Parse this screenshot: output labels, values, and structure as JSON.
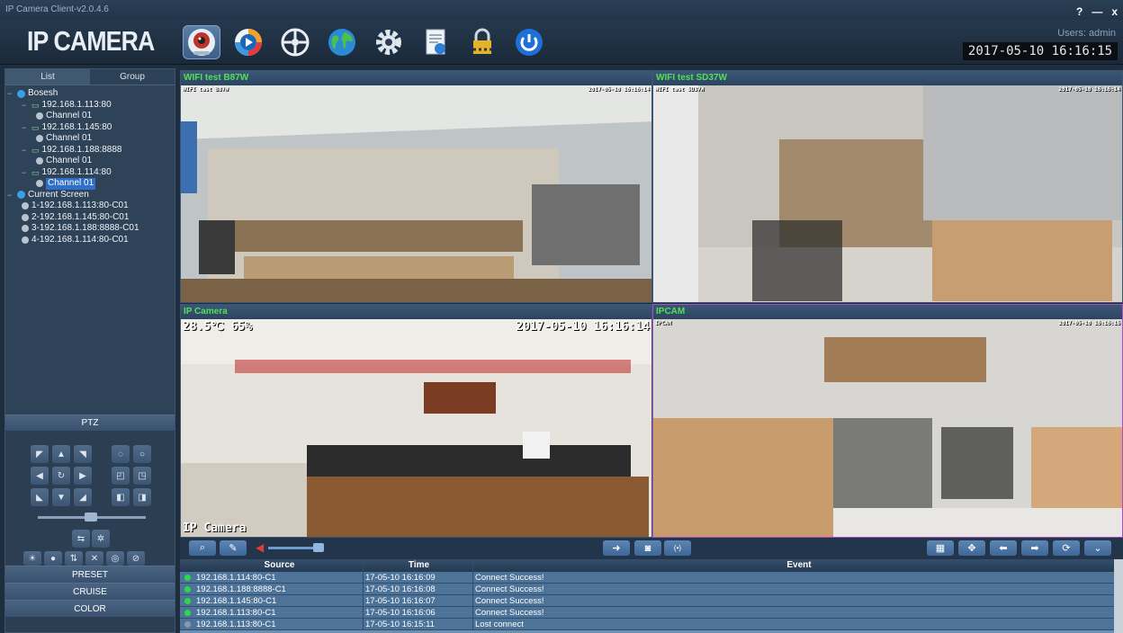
{
  "window": {
    "title": "IP Camera Client-v2.0.4.6",
    "controls": [
      "?",
      "—",
      "x"
    ]
  },
  "header": {
    "logo": "IP CAMERA",
    "user": "Users: admin",
    "clock": "2017-05-10 16:16:15",
    "toolbar": [
      "live-view",
      "playback",
      "ptz-control",
      "network",
      "settings",
      "log",
      "lock",
      "power"
    ]
  },
  "left": {
    "tabs": [
      "List",
      "Group"
    ],
    "tree": [
      {
        "text": "Bosesh",
        "level": 0,
        "kind": "group"
      },
      {
        "text": "192.168.1.113:80",
        "level": 1,
        "kind": "device"
      },
      {
        "text": "Channel 01",
        "level": 2,
        "kind": "channel"
      },
      {
        "text": "192.168.1.145:80",
        "level": 1,
        "kind": "device"
      },
      {
        "text": "Channel 01",
        "level": 2,
        "kind": "channel"
      },
      {
        "text": "192.168.1.188:8888",
        "level": 1,
        "kind": "device"
      },
      {
        "text": "Channel 01",
        "level": 2,
        "kind": "channel"
      },
      {
        "text": "192.168.1.114:80",
        "level": 1,
        "kind": "device"
      },
      {
        "text": "Channel 01",
        "level": 2,
        "kind": "channel",
        "selected": true
      },
      {
        "text": "Current Screen",
        "level": 0,
        "kind": "group"
      },
      {
        "text": "1-192.168.1.113:80-C01",
        "level": 1,
        "kind": "screen"
      },
      {
        "text": "2-192.168.1.145:80-C01",
        "level": 1,
        "kind": "screen"
      },
      {
        "text": "3-192.168.1.188:8888-C01",
        "level": 1,
        "kind": "screen"
      },
      {
        "text": "4-192.168.1.114:80-C01",
        "level": 1,
        "kind": "screen"
      }
    ],
    "ptz": "PTZ",
    "preset": "PRESET",
    "cruise": "CRUISE",
    "color": "COLOR"
  },
  "panes": [
    {
      "title": "WIFI test B87W",
      "osd": "WIFI test B87W",
      "time": "2017-05-10 16:16:14"
    },
    {
      "title": "WIFI test SD37W",
      "osd": "WIFI test SD37W",
      "time": "2017-05-10 16:16:14"
    },
    {
      "title": "IP Camera",
      "osd_top": "28.5℃ 65%",
      "osd_time": "2017-05-10 16:16:14",
      "osd_bottom": "IP Camera"
    },
    {
      "title": "IPCAM",
      "osd": "IPCAM",
      "time": "2017-05-10 16:16:15"
    }
  ],
  "log": {
    "headers": [
      "Source",
      "Time",
      "Event"
    ],
    "rows": [
      {
        "source": "192.168.1.114:80-C1",
        "time": "17-05-10 16:16:09",
        "event": "Connect Success!",
        "status": "ok"
      },
      {
        "source": "192.168.1.188:8888-C1",
        "time": "17-05-10 16:16:08",
        "event": "Connect Success!",
        "status": "ok"
      },
      {
        "source": "192.168.1.145:80-C1",
        "time": "17-05-10 16:16:07",
        "event": "Connect Success!",
        "status": "ok"
      },
      {
        "source": "192.168.1.113:80-C1",
        "time": "17-05-10 16:16:06",
        "event": "Connect Success!",
        "status": "ok"
      },
      {
        "source": "192.168.1.113:80-C1",
        "time": "17-05-10 16:15:11",
        "event": "Lost connect",
        "status": "lost"
      }
    ]
  },
  "colors": {
    "ok": "#2ed84a",
    "lost": "#8a9aa8",
    "accent": "#52e056",
    "selectedBorder": "#b04cc6"
  }
}
